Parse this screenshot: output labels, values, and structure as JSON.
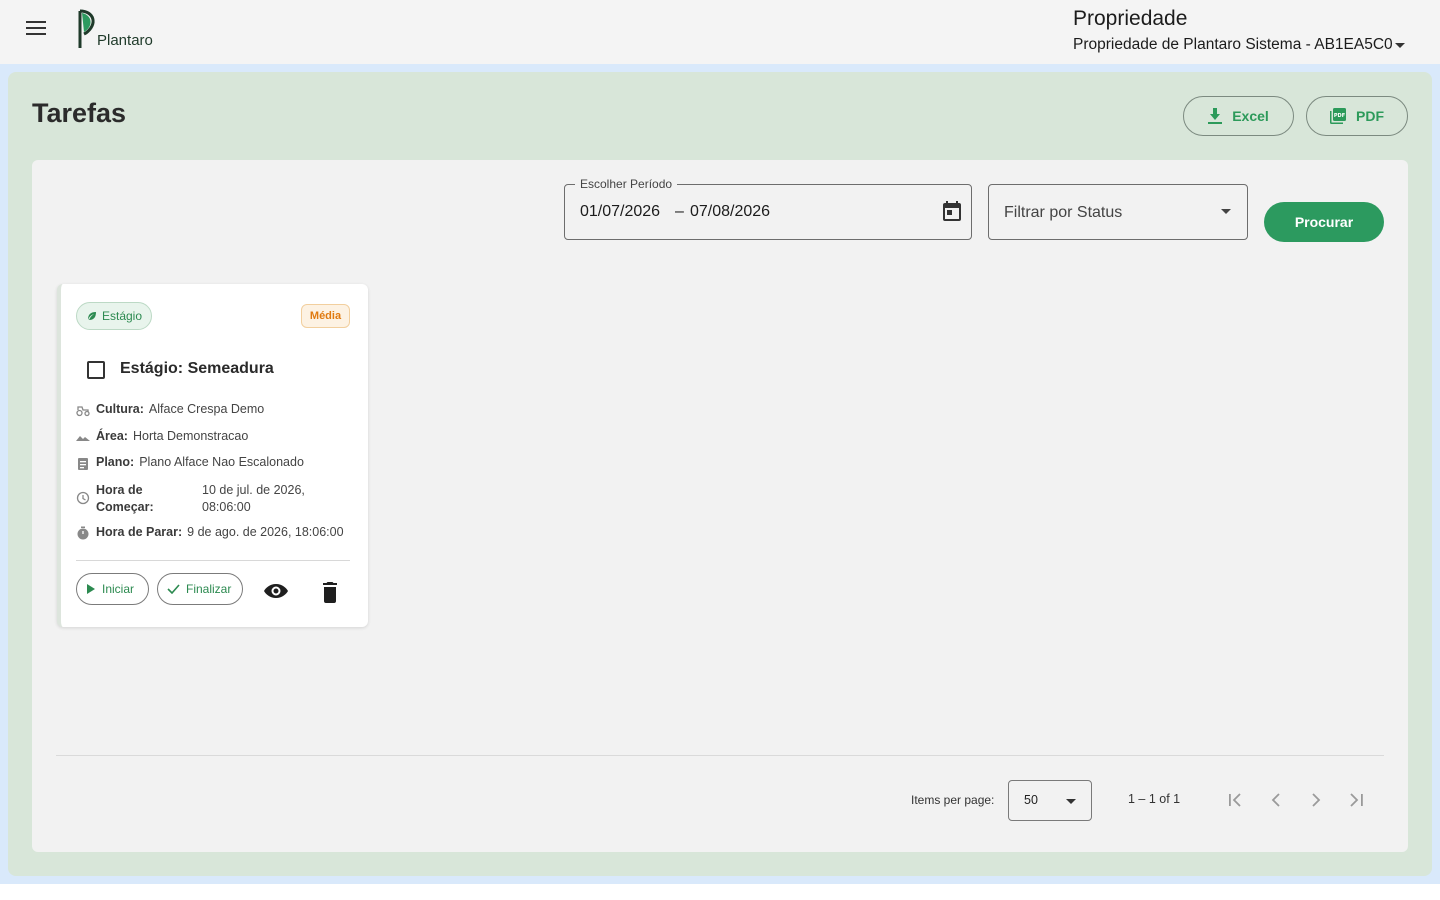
{
  "header": {
    "logo_text": "Plantaro",
    "property_title": "Propriedade",
    "property_selected": "Propriedade de Plantaro Sistema - AB1EA5C0"
  },
  "page": {
    "title": "Tarefas",
    "excel_label": "Excel",
    "pdf_label": "PDF"
  },
  "filters": {
    "period_label": "Escolher Período",
    "date_start": "01/07/2026",
    "date_separator": "–",
    "date_end": "07/08/2026",
    "status_placeholder": "Filtrar por Status",
    "search_label": "Procurar"
  },
  "task": {
    "type_label": "Estágio",
    "priority_label": "Média",
    "title": "Estágio: Semeadura",
    "cultura_label": "Cultura:",
    "cultura_value": "Alface Crespa Demo",
    "area_label": "Área:",
    "area_value": "Horta Demonstracao",
    "plano_label": "Plano:",
    "plano_value": "Plano Alface Nao Escalonado",
    "start_label": "Hora de Começar:",
    "start_value": "10 de jul. de 2026, 08:06:00",
    "stop_label": "Hora de Parar:",
    "stop_value": "9 de ago. de 2026, 18:06:00",
    "start_button": "Iniciar",
    "finish_button": "Finalizar"
  },
  "paginator": {
    "items_per_page_label": "Items per page:",
    "items_per_page_value": "50",
    "range_label": "1 – 1 of 1"
  },
  "colors": {
    "primary_green": "#2c9a5f",
    "panel_green": "#d8e6d9",
    "priority_orange": "#e07a10"
  },
  "icons": [
    "menu-icon",
    "download-icon",
    "pdf-icon",
    "calendar-icon",
    "leaf-icon",
    "tractor-icon",
    "terrain-icon",
    "clipboard-icon",
    "clock-icon",
    "timer-icon",
    "play-icon",
    "check-icon",
    "eye-icon",
    "trash-icon",
    "first-page-icon",
    "prev-page-icon",
    "next-page-icon",
    "last-page-icon"
  ]
}
